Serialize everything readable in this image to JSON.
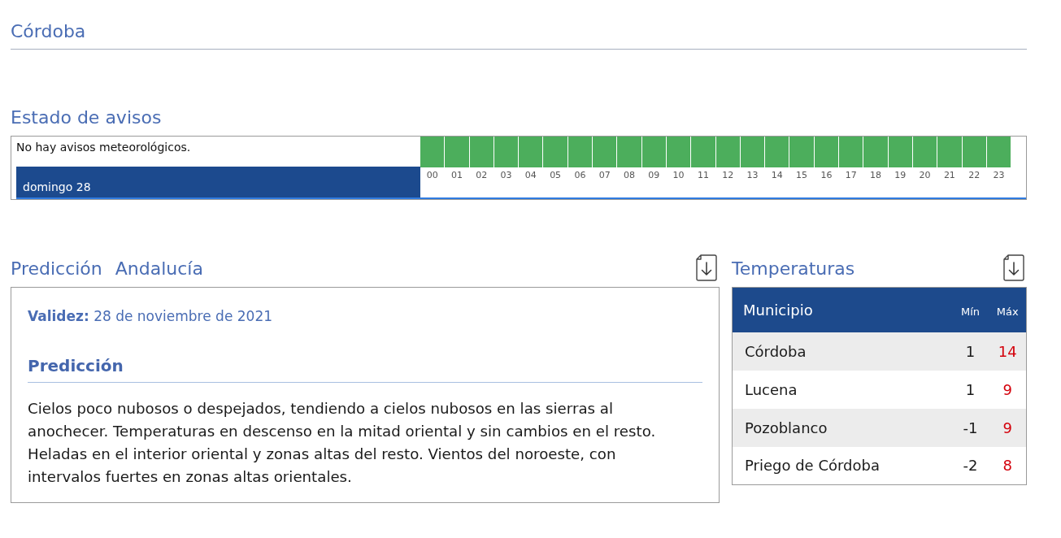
{
  "header": {
    "title": "Córdoba"
  },
  "warnings": {
    "title": "Estado de avisos",
    "message": "No hay avisos meteorológicos.",
    "day": "domingo 28",
    "hours": [
      {
        "label": "00",
        "color": "#4cae5c"
      },
      {
        "label": "01",
        "color": "#4cae5c"
      },
      {
        "label": "02",
        "color": "#4cae5c"
      },
      {
        "label": "03",
        "color": "#4cae5c"
      },
      {
        "label": "04",
        "color": "#4cae5c"
      },
      {
        "label": "05",
        "color": "#4cae5c"
      },
      {
        "label": "06",
        "color": "#4cae5c"
      },
      {
        "label": "07",
        "color": "#4cae5c"
      },
      {
        "label": "08",
        "color": "#4cae5c"
      },
      {
        "label": "09",
        "color": "#4cae5c"
      },
      {
        "label": "10",
        "color": "#4cae5c"
      },
      {
        "label": "11",
        "color": "#4cae5c"
      },
      {
        "label": "12",
        "color": "#4cae5c"
      },
      {
        "label": "13",
        "color": "#4cae5c"
      },
      {
        "label": "14",
        "color": "#4cae5c"
      },
      {
        "label": "15",
        "color": "#4cae5c"
      },
      {
        "label": "16",
        "color": "#4cae5c"
      },
      {
        "label": "17",
        "color": "#4cae5c"
      },
      {
        "label": "18",
        "color": "#4cae5c"
      },
      {
        "label": "19",
        "color": "#4cae5c"
      },
      {
        "label": "20",
        "color": "#4cae5c"
      },
      {
        "label": "21",
        "color": "#4cae5c"
      },
      {
        "label": "22",
        "color": "#4cae5c"
      },
      {
        "label": "23",
        "color": "#4cae5c"
      }
    ]
  },
  "forecast": {
    "title": "Predicción",
    "region": "Andalucía",
    "validity": "**Validez:** 28 de noviembre de 2021",
    "section_title": "Predicción",
    "text": "Cielos poco nubosos o despejados, tendiendo a cielos nubosos en las sierras al anochecer. Temperaturas en descenso en la mitad oriental y sin cambios en el resto. Heladas en el interior oriental y zonas altas del resto. Vientos del noroeste, con intervalos fuertes en zonas altas orientales."
  },
  "temperatures": {
    "title": "Temperaturas",
    "columns": [
      "Municipio",
      "Mín",
      "Máx"
    ],
    "rows": [
      {
        "municipality": "Córdoba",
        "min": "1",
        "max": "14"
      },
      {
        "municipality": "Lucena",
        "min": "1",
        "max": "9"
      },
      {
        "municipality": "Pozoblanco",
        "min": "-1",
        "max": "9"
      },
      {
        "municipality": "Priego de Córdoba",
        "min": "-2",
        "max": "8"
      }
    ]
  }
}
